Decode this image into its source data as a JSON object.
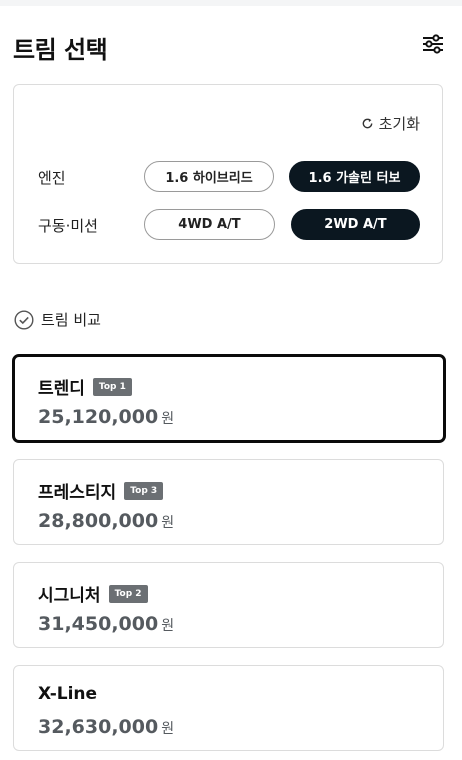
{
  "header": {
    "title": "트림 선택",
    "filter_icon": "sliders-icon"
  },
  "options": {
    "reset_label": "초기화",
    "reset_icon": "refresh-icon",
    "engine": {
      "label": "엔진",
      "choices": [
        {
          "label": "1.6 하이브리드",
          "selected": false
        },
        {
          "label": "1.6 가솔린 터보",
          "selected": true
        }
      ]
    },
    "drivetrain": {
      "label": "구동·미션",
      "choices": [
        {
          "label": "4WD A/T",
          "selected": false
        },
        {
          "label": "2WD A/T",
          "selected": true
        }
      ]
    }
  },
  "compare": {
    "label": "트림 비교",
    "icon": "check-circle-icon",
    "checked": false
  },
  "trims": [
    {
      "name": "트렌디",
      "badge": "Top 1",
      "price": "25,120,000",
      "currency": "원",
      "selected": true
    },
    {
      "name": "프레스티지",
      "badge": "Top 3",
      "price": "28,800,000",
      "currency": "원",
      "selected": false
    },
    {
      "name": "시그니처",
      "badge": "Top 2",
      "price": "31,450,000",
      "currency": "원",
      "selected": false
    },
    {
      "name": "X-Line",
      "badge": "",
      "price": "32,630,000",
      "currency": "원",
      "selected": false
    }
  ],
  "colors": {
    "selected_pill": "#0b1720",
    "badge": "#6b6f73",
    "price": "#555a5f"
  }
}
